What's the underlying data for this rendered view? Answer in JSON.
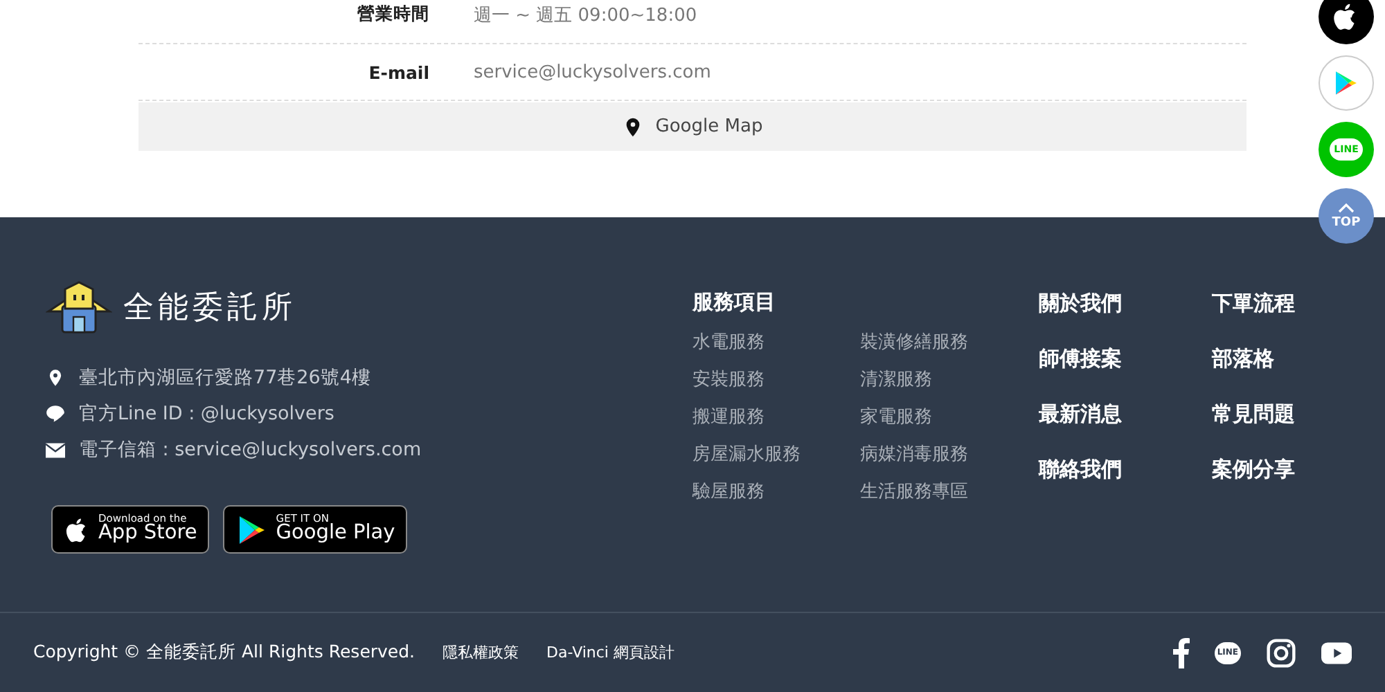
{
  "contact_table": {
    "rows": [
      {
        "label": "營業時間",
        "value": "週一 ~ 週五 09:00~18:00"
      },
      {
        "label": "E-mail",
        "value": "service@luckysolvers.com"
      }
    ],
    "map_button": "Google Map"
  },
  "side_buttons": [
    {
      "kind": "apple"
    },
    {
      "kind": "google-play"
    },
    {
      "kind": "line",
      "label": "LINE"
    },
    {
      "kind": "top",
      "label": "TOP"
    }
  ],
  "footer": {
    "brand": "全能委託所",
    "contacts": [
      {
        "kind": "pin",
        "text": "臺北市內湖區行愛路77巷26號4樓"
      },
      {
        "kind": "line",
        "text": "官方Line ID : @luckysolvers"
      },
      {
        "kind": "mail",
        "text": "電子信箱 : service@luckysolvers.com"
      }
    ],
    "store_badges": [
      {
        "kind": "apple",
        "small": "Download on the",
        "big": "App Store"
      },
      {
        "kind": "google-play",
        "small": "GET IT ON",
        "big": "Google Play"
      }
    ],
    "services": {
      "title": "服務項目",
      "items": [
        "水電服務",
        "裝潢修繕服務",
        "安裝服務",
        "清潔服務",
        "搬運服務",
        "家電服務",
        "房屋漏水服務",
        "病媒消毒服務",
        "驗屋服務",
        "生活服務專區"
      ]
    },
    "links": [
      "關於我們",
      "下單流程",
      "師傅接案",
      "部落格",
      "最新消息",
      "常見問題",
      "聯絡我們",
      "案例分享"
    ],
    "copyright": "Copyright © 全能委託所 All Rights Reserved.",
    "bottom_links": [
      "隱私權政策",
      "Da-Vinci 網頁設計"
    ],
    "social": [
      {
        "kind": "facebook"
      },
      {
        "kind": "line",
        "label": "LINE"
      },
      {
        "kind": "instagram"
      },
      {
        "kind": "youtube"
      }
    ]
  }
}
